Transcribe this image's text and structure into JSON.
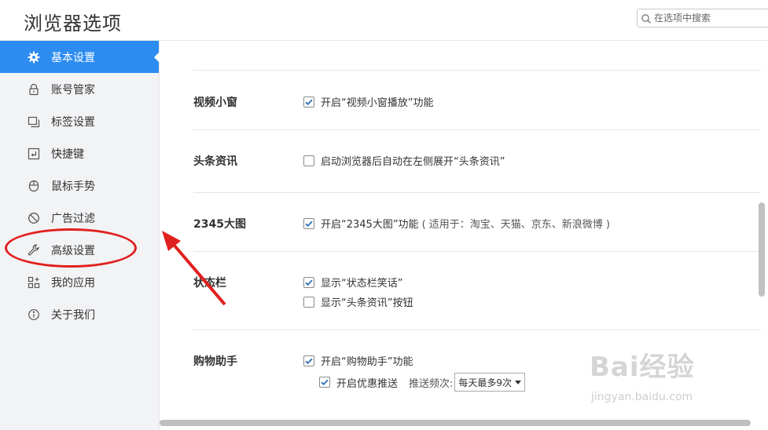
{
  "header": {
    "title": "浏览器选项",
    "search_placeholder": "在选项中搜索"
  },
  "sidebar": {
    "items": [
      {
        "label": "基本设置",
        "icon": "gear-icon",
        "active": true
      },
      {
        "label": "账号管家",
        "icon": "lock-icon"
      },
      {
        "label": "标签设置",
        "icon": "tabs-icon"
      },
      {
        "label": "快捷键",
        "icon": "keyboard-icon"
      },
      {
        "label": "鼠标手势",
        "icon": "mouse-icon"
      },
      {
        "label": "广告过滤",
        "icon": "block-icon"
      },
      {
        "label": "高级设置",
        "icon": "wrench-icon"
      },
      {
        "label": "我的应用",
        "icon": "apps-icon"
      },
      {
        "label": "关于我们",
        "icon": "info-icon"
      }
    ]
  },
  "sections": {
    "video": {
      "label": "视频小窗",
      "opt1": "开启“视频小窗播放”功能",
      "opt1_checked": true
    },
    "news": {
      "label": "头条资讯",
      "opt1": "启动浏览器后自动在左侧展开“头条资讯”",
      "opt1_checked": false
    },
    "bigpic": {
      "label": "2345大图",
      "opt1": "开启“2345大图”功能",
      "note": "( 适用于：淘宝、天猫、京东、新浪微博 )",
      "opt1_checked": true
    },
    "status": {
      "label": "状态栏",
      "opt1": "显示“状态栏笑话”",
      "opt1_checked": true,
      "opt2": "显示“头条资讯”按钮",
      "opt2_checked": false
    },
    "shopping": {
      "label": "购物助手",
      "opt1": "开启“购物助手”功能",
      "opt1_checked": true,
      "opt2": "开启优惠推送",
      "opt2_checked": true,
      "freq_label": "推送频次:",
      "freq_value": "每天最多9次"
    }
  },
  "watermark": {
    "text": "Bai经验",
    "sub": "jingyan.baidu.com"
  },
  "colors": {
    "accent": "#2d8cf0",
    "annotation": "#e0201e"
  }
}
